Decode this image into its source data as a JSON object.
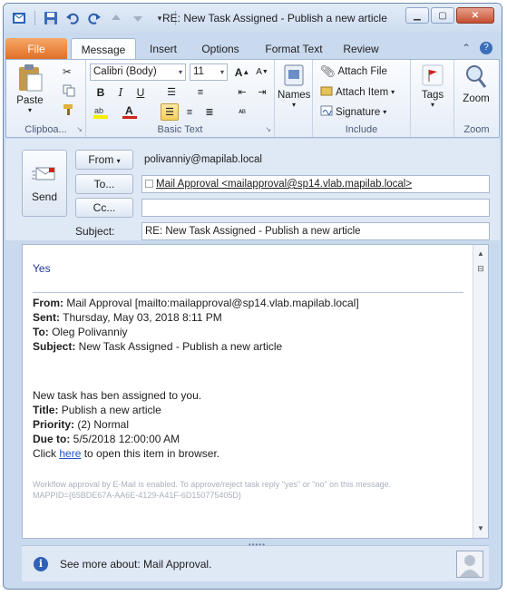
{
  "window": {
    "title": "RE: New Task Assigned - Publish a new article"
  },
  "tabs": [
    "File",
    "Message",
    "Insert",
    "Options",
    "Format Text",
    "Review"
  ],
  "ribbon": {
    "clipboard": {
      "label": "Clipboa...",
      "paste": "Paste"
    },
    "basic_text": {
      "label": "Basic Text",
      "font": "Calibri (Body)",
      "size": "11"
    },
    "names": {
      "label": "Names"
    },
    "include": {
      "label": "Include",
      "attach_file": "Attach File",
      "attach_item": "Attach Item",
      "signature": "Signature"
    },
    "tags": {
      "label": "Tags"
    },
    "zoom": {
      "label": "Zoom",
      "zoom_btn": "Zoom"
    }
  },
  "header": {
    "send": "Send",
    "from_btn": "From",
    "from_value": "polivanniy@mapilab.local",
    "to_btn": "To...",
    "to_value": "Mail Approval <mailapproval@sp14.vlab.mapilab.local>",
    "cc_btn": "Cc...",
    "cc_value": "",
    "subject_label": "Subject:",
    "subject_value": "RE: New Task Assigned - Publish a new article"
  },
  "body": {
    "reply": "Yes",
    "from_label": "From:",
    "from_value": " Mail Approval [mailto:mailapproval@sp14.vlab.mapilab.local]",
    "sent_label": "Sent:",
    "sent_value": " Thursday, May 03, 2018 8:11 PM",
    "to_label": "To:",
    "to_value": " Oleg Polivanniy",
    "subject_label": "Subject:",
    "subject_value": " New Task Assigned - Publish a new article",
    "intro": "New task has ben assigned to you.",
    "title_label": "Title:",
    "title_value": " Publish a new article",
    "priority_label": "Priority:",
    "priority_value": " (2) Normal",
    "due_label": "Due to:",
    "due_value": " 5/5/2018 12:00:00 AM",
    "click_pre": "Click ",
    "click_link": "here",
    "click_post": " to open this item in browser.",
    "footer_line1": "Workflow approval by E-Mail is enabled. To approve/reject task reply \"yes\" or \"no\" on this message.",
    "footer_line2": "MAPPID={65BDE67A-AA6E-4129-A41F-6D150775405D}"
  },
  "people_pane": {
    "text": "See more about: Mail Approval."
  }
}
